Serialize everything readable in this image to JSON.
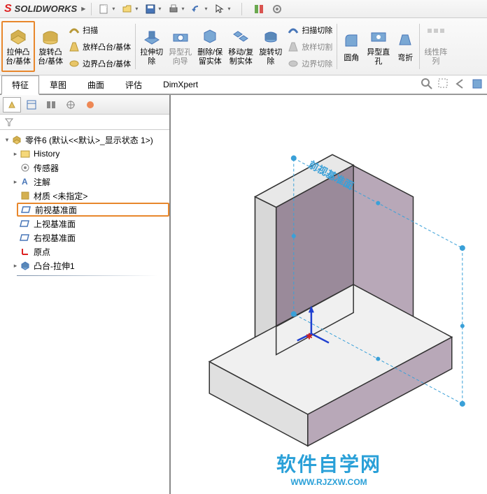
{
  "app": {
    "name": "SOLIDWORKS"
  },
  "ribbon": {
    "extrude_boss": "拉伸凸\n台/基体",
    "revolve_boss": "旋转凸\n台/基体",
    "swept": "扫描",
    "lofted": "放样凸台/基体",
    "boundary": "边界凸台/基体",
    "extrude_cut": "拉伸切\n除",
    "hole": "异型孔\n向导",
    "revolve_cut": "旋转切\n除",
    "swept_cut": "扫描切除",
    "lofted_cut": "放样切割",
    "boundary_cut": "边界切除",
    "fillet": "圆角",
    "linear_pattern": "线性阵\n列",
    "move_copy": "移动/复\n制实体",
    "delete_keep": "删除/保\n留实体",
    "center_hole": "异型直\n孔",
    "draft": "弯折"
  },
  "tabs": {
    "features": "特征",
    "sketch": "草图",
    "surface": "曲面",
    "evaluate": "评估",
    "dimxpert": "DimXpert"
  },
  "tree": {
    "root": "零件6 (默认<<默认>_显示状态 1>)",
    "history": "History",
    "sensors": "传感器",
    "annotations": "注解",
    "material": "材质 <未指定>",
    "front_plane": "前视基准面",
    "top_plane": "上视基准面",
    "right_plane": "右视基准面",
    "origin": "原点",
    "extrude1": "凸台-拉伸1"
  },
  "viewport": {
    "plane_label": "前视基准面"
  },
  "watermark": {
    "text": "软件自学网",
    "url": "WWW.RJZXW.COM"
  }
}
